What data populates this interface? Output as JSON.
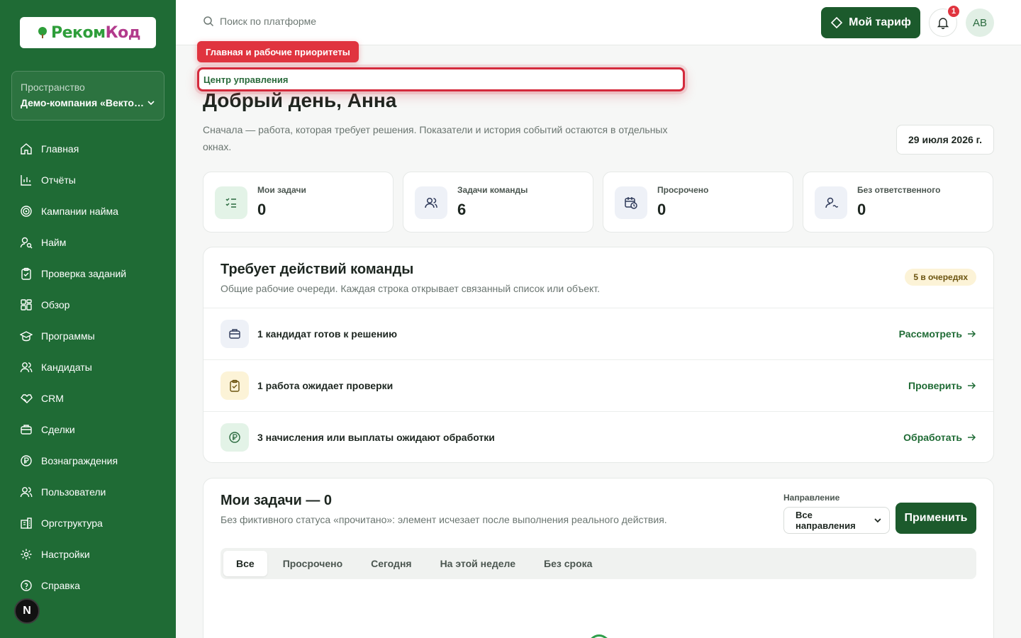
{
  "brand": {
    "logo_part1": "Реком",
    "logo_part2": "Код"
  },
  "workspace": {
    "label": "Пространство",
    "value": "Демо-компания «Векто…"
  },
  "nav": [
    {
      "label": "Главная",
      "icon": "home-icon"
    },
    {
      "label": "Отчёты",
      "icon": "chart-icon"
    },
    {
      "label": "Кампании найма",
      "icon": "target-icon"
    },
    {
      "label": "Найм",
      "icon": "user-search-icon"
    },
    {
      "label": "Проверка заданий",
      "icon": "clipboard-check-icon"
    },
    {
      "label": "Обзор",
      "icon": "grid-icon"
    },
    {
      "label": "Программы",
      "icon": "graduation-cap-icon"
    },
    {
      "label": "Кандидаты",
      "icon": "users-icon"
    },
    {
      "label": "CRM",
      "icon": "handshake-icon"
    },
    {
      "label": "Сделки",
      "icon": "briefcase-icon"
    },
    {
      "label": "Вознаграждения",
      "icon": "ruble-coin-icon"
    },
    {
      "label": "Пользователи",
      "icon": "users-icon"
    },
    {
      "label": "Оргструктура",
      "icon": "building-icon"
    },
    {
      "label": "Настройки",
      "icon": "gear-icon"
    },
    {
      "label": "Справка",
      "icon": "help-circle-icon"
    }
  ],
  "dev_badge": "N",
  "topbar": {
    "search_placeholder": "Поиск по платформе",
    "tariff_label": "Мой тариф",
    "notifications_count": "1",
    "avatar_initials": "AB"
  },
  "tour": {
    "chip": "Главная и рабочие приоритеты",
    "highlight": "Центр управления"
  },
  "header": {
    "greeting": "Добрый день, Анна",
    "subtitle": "Сначала — работа, которая требует решения. Показатели и история событий остаются в отдельных окнах.",
    "date": "29 июля 2026 г."
  },
  "stats": [
    {
      "label": "Мои задачи",
      "value": "0",
      "icon": "checklist-icon"
    },
    {
      "label": "Задачи команды",
      "value": "6",
      "icon": "users-icon"
    },
    {
      "label": "Просрочено",
      "value": "0",
      "icon": "calendar-clock-icon"
    },
    {
      "label": "Без ответственного",
      "value": "0",
      "icon": "user-unassigned-icon"
    }
  ],
  "team_actions": {
    "title": "Требует действий команды",
    "description": "Общие рабочие очереди. Каждая строка открывает связанный список или объект.",
    "badge": "5 в очередях",
    "rows": [
      {
        "text": "1 кандидат готов к решению",
        "action": "Рассмотреть",
        "icon": "briefcase-icon"
      },
      {
        "text": "1 работа ожидает проверки",
        "action": "Проверить",
        "icon": "clipboard-check-icon"
      },
      {
        "text": "3 начисления или выплаты ожидают обработки",
        "action": "Обработать",
        "icon": "ruble-coin-icon"
      }
    ]
  },
  "my_tasks": {
    "title": "Мои задачи — 0",
    "description": "Без фиктивного статуса «прочитано»: элемент исчезает после выполнения реального действия.",
    "direction_label": "Направление",
    "direction_value": "Все направления",
    "apply_label": "Применить",
    "tabs": [
      "Все",
      "Просрочено",
      "Сегодня",
      "На этой неделе",
      "Без срока"
    ]
  },
  "colors": {
    "sidebar": "#1f6b35",
    "accent": "#1c5a2c",
    "alert": "#e0343f"
  }
}
